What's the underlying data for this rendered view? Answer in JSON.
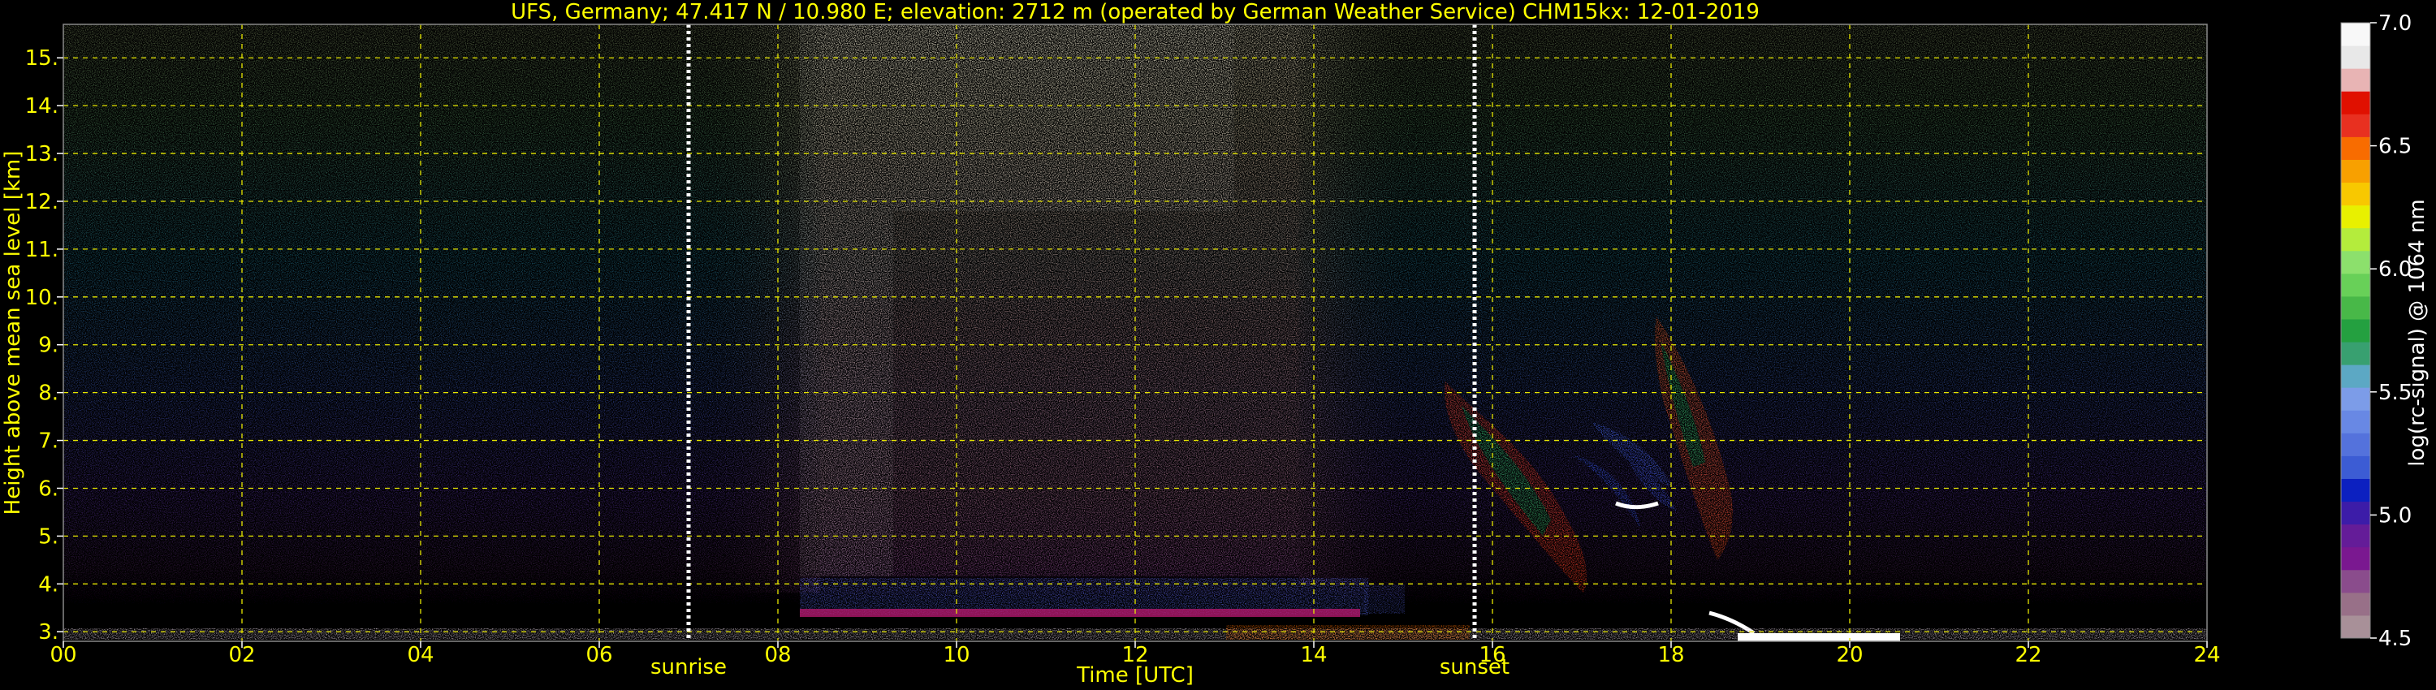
{
  "chart_data": {
    "type": "heatmap",
    "title": "UFS, Germany; 47.417 N / 10.980 E; elevation: 2712 m  (operated by German Weather Service)    CHM15kx: 12-01-2019",
    "xlabel": "Time [UTC]",
    "ylabel": "Height above mean sea level [km]",
    "x_ticks": [
      "00",
      "02",
      "04",
      "06",
      "08",
      "10",
      "12",
      "14",
      "16",
      "18",
      "20",
      "22",
      "24"
    ],
    "y_ticks": [
      "3.",
      "4.",
      "5.",
      "6.",
      "7.",
      "8.",
      "9.",
      "10.",
      "11.",
      "12.",
      "13.",
      "14.",
      "15."
    ],
    "xlim": [
      0,
      24
    ],
    "ylim": [
      2.8,
      15.7
    ],
    "grid": true,
    "events": [
      {
        "label": "sunrise",
        "time": 7.0
      },
      {
        "label": "sunset",
        "time": 15.8
      }
    ],
    "colorbar": {
      "label": "log(rc-signal) @ 1064 nm",
      "range": [
        4.5,
        7.0
      ],
      "ticks": [
        "4.5",
        "5.0",
        "5.5",
        "6.0",
        "6.5",
        "7.0"
      ],
      "colors": [
        "#a89098",
        "#987088",
        "#8a4c8c",
        "#7a1890",
        "#641c98",
        "#3c1ca8",
        "#0c20c0",
        "#3c5cd4",
        "#5472dc",
        "#6888e4",
        "#7c9ce8",
        "#5ca8c4",
        "#38a070",
        "#24a040",
        "#48b848",
        "#68d058",
        "#8ce06c",
        "#b4ec3c",
        "#e8f000",
        "#f8c800",
        "#f8a000",
        "#f86c00",
        "#e83020",
        "#e01000",
        "#e8b4b4",
        "#e8e8e8",
        "#f8f8f8"
      ]
    }
  }
}
